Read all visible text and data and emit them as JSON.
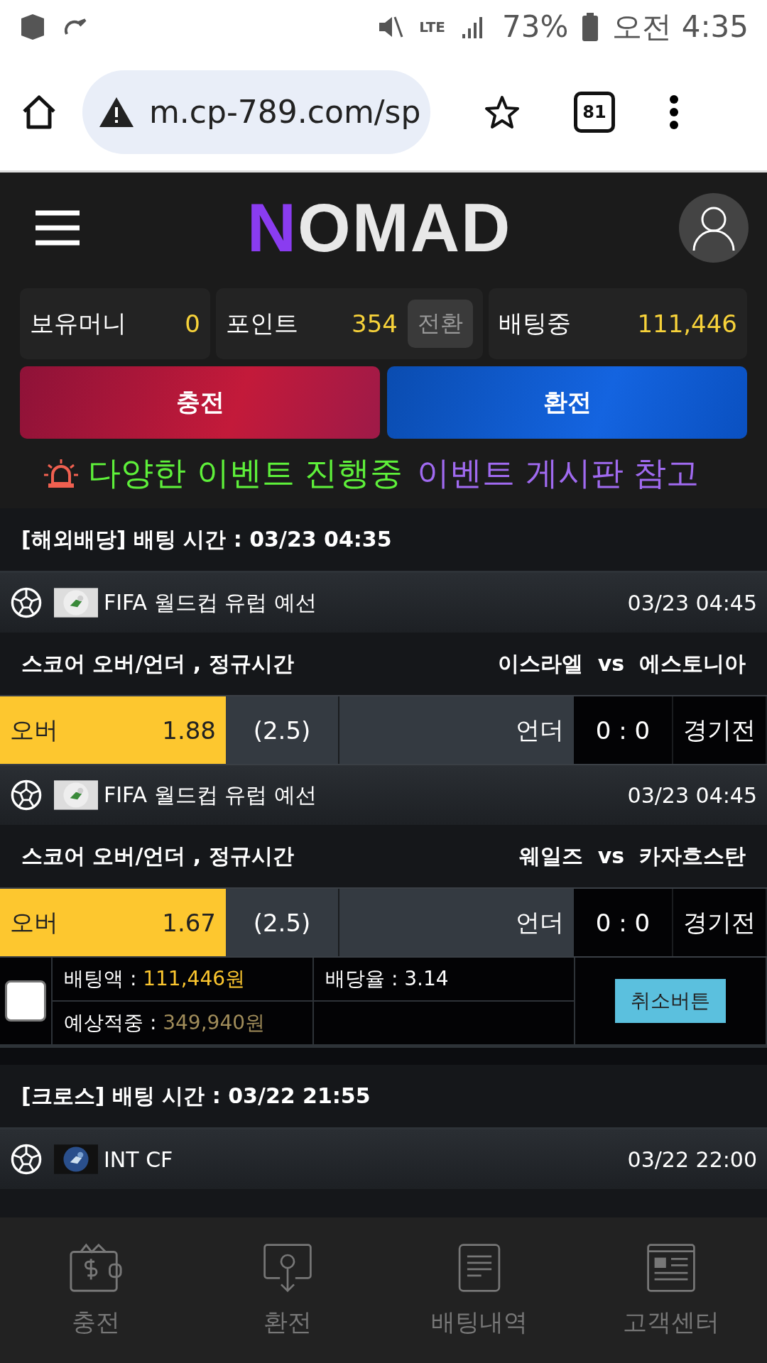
{
  "status_bar": {
    "network": "LTE",
    "battery": "73%",
    "time": "오전 4:35"
  },
  "browser": {
    "url": "m.cp-789.com/sp",
    "tab_count": "81"
  },
  "header": {
    "logo_mark": "N",
    "logo_text": "OMAD"
  },
  "balances": [
    {
      "label": "보유머니",
      "value": "0"
    },
    {
      "label": "포인트",
      "value": "354",
      "action": "전환"
    },
    {
      "label": "배팅중",
      "value": "111,446"
    }
  ],
  "actions": [
    {
      "label": "충전",
      "kind": "deposit"
    },
    {
      "label": "환전",
      "kind": "withdraw"
    }
  ],
  "notice": {
    "highlight": "다양한 이벤트 진행중",
    "text": "이벤트 게시판 참고"
  },
  "sections": [
    {
      "title": "[해외배당] 배팅 시간 : 03/23 04:35",
      "matches": [
        {
          "league": "FIFA 월드컵 유럽 예선",
          "start": "03/23 04:45",
          "market": "스코어 오버/언더 , 정규시간",
          "teams": "이스라엘  vs  에스토니아",
          "over": {
            "label": "오버",
            "odds": "1.88",
            "selected": true
          },
          "line": "(2.5)",
          "under": {
            "label": "언더",
            "selected": false
          },
          "score": "0 : 0",
          "status": "경기전"
        },
        {
          "league": "FIFA 월드컵 유럽 예선",
          "start": "03/23 04:45",
          "market": "스코어 오버/언더 , 정규시간",
          "teams": "웨일즈  vs  카자흐스탄",
          "over": {
            "label": "오버",
            "odds": "1.67",
            "selected": true
          },
          "line": "(2.5)",
          "under": {
            "label": "언더",
            "selected": false
          },
          "score": "0 : 0",
          "status": "경기전"
        }
      ],
      "summary": {
        "checked": false,
        "stake_label": "배팅액 : ",
        "stake": "111,446원",
        "rate_label": "배당율 : ",
        "rate": "3.14",
        "payout_label": "예상적중 : ",
        "payout": "349,940원",
        "cancel": "취소버튼"
      }
    },
    {
      "title": "[크로스] 배팅 시간 : 03/22 21:55",
      "matches": [
        {
          "league": "INT CF",
          "start": "03/22 22:00"
        }
      ]
    }
  ],
  "bottom_nav": [
    {
      "label": "충전",
      "kind": "wallet"
    },
    {
      "label": "환전",
      "kind": "exchange"
    },
    {
      "label": "배팅내역",
      "kind": "history"
    },
    {
      "label": "고객센터",
      "kind": "support"
    }
  ]
}
